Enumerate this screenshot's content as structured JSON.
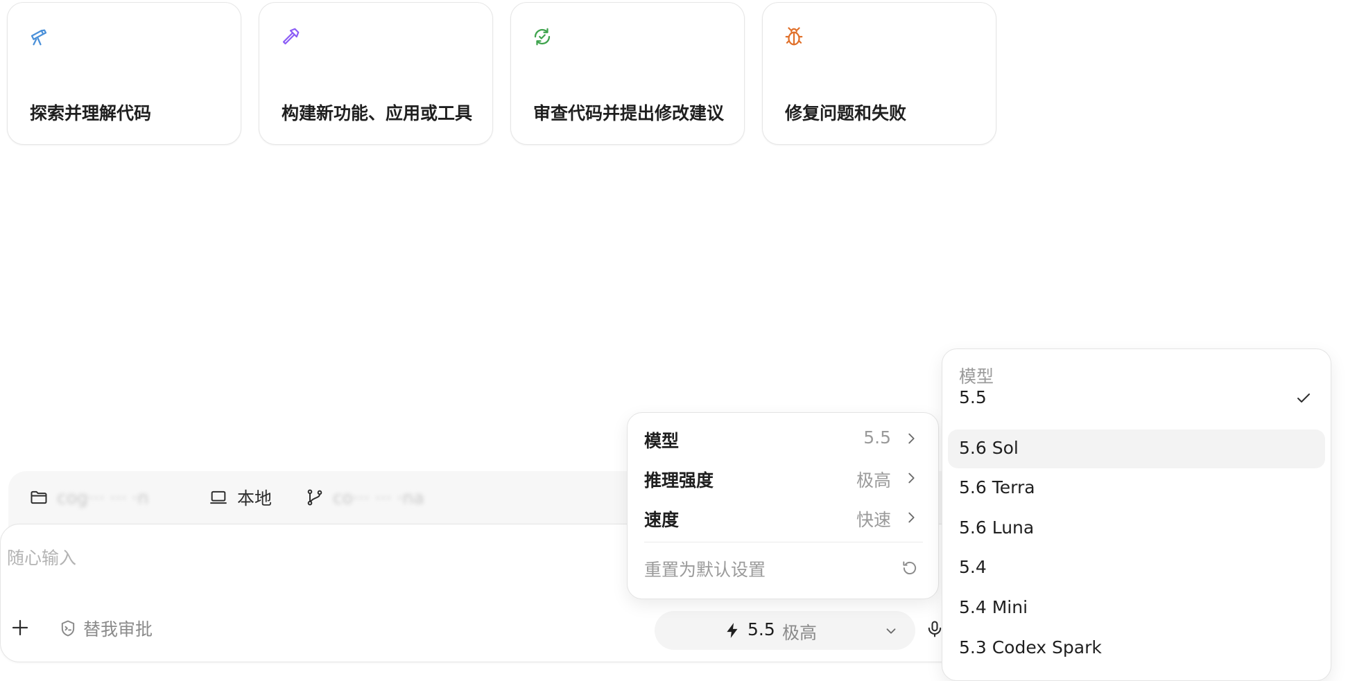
{
  "cards": [
    {
      "label": "探索并理解代码",
      "icon": "telescope-icon",
      "color": "#4a90d9"
    },
    {
      "label": "构建新功能、应用或工具",
      "icon": "hammer-icon",
      "color": "#8b5cf6"
    },
    {
      "label": "审查代码并提出修改建议",
      "icon": "refresh-check-icon",
      "color": "#3fa34d"
    },
    {
      "label": "修复问题和失败",
      "icon": "bug-icon",
      "color": "#e0702a"
    }
  ],
  "context_bar": {
    "folder_label": "cog··· ··· ·n",
    "environment_label": "本地",
    "branch_label": "co··· ··· ·na"
  },
  "composer": {
    "placeholder": "随心输入",
    "approve_label": "替我审批",
    "picker_value": "5.5",
    "picker_reasoning": "极高"
  },
  "settings_menu": {
    "items": [
      {
        "label": "模型",
        "value": "5.5"
      },
      {
        "label": "推理强度",
        "value": "极高"
      },
      {
        "label": "速度",
        "value": "快速"
      }
    ],
    "reset_label": "重置为默认设置"
  },
  "model_menu": {
    "title": "模型",
    "options": [
      {
        "name": "5.5",
        "selected": true
      },
      {
        "name": "5.6 Sol",
        "hover": true
      },
      {
        "name": "5.6 Terra"
      },
      {
        "name": "5.6 Luna"
      },
      {
        "name": "5.4"
      },
      {
        "name": "5.4 Mini"
      },
      {
        "name": "5.3 Codex Spark"
      }
    ]
  }
}
